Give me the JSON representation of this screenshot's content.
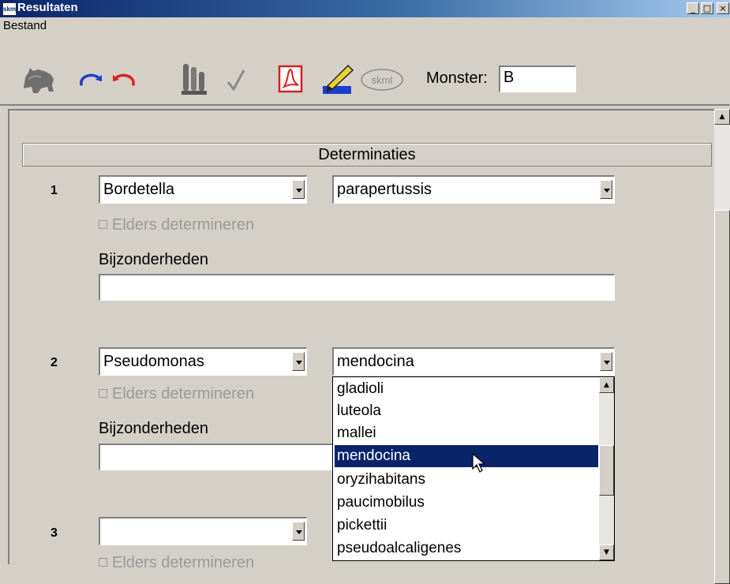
{
  "window": {
    "title": "Resultaten",
    "icon_text": "skml",
    "min_glyph": "_",
    "max_glyph": "□",
    "close_glyph": "×"
  },
  "menu": {
    "bestand": "Bestand"
  },
  "toolbar": {
    "icons": [
      "animal-icon",
      "redo-icon",
      "undo-icon",
      "test-tubes-icon",
      "checkmark-icon",
      "pdf-icon",
      "pen-sign-icon",
      "skml-logo-icon"
    ],
    "skml_text": "skml",
    "monster_label": "Monster:",
    "monster_value": "B"
  },
  "section": {
    "title": "Determinaties"
  },
  "rows": [
    {
      "num": "1",
      "genus": "Bordetella",
      "species": "parapertussis",
      "elders_label": "Elders determineren",
      "bijz_label": "Bijzonderheden",
      "bijz_value": ""
    },
    {
      "num": "2",
      "genus": "Pseudomonas",
      "species": "mendocina",
      "elders_label": "Elders determineren",
      "bijz_label": "Bijzonderheden",
      "bijz_value": ""
    },
    {
      "num": "3",
      "genus": "",
      "elders_label": "Elders determineren"
    }
  ],
  "dropdown": {
    "items": [
      "gladioli",
      "luteola",
      "mallei",
      "mendocina",
      "oryzihabitans",
      "paucimobilus",
      "pickettii",
      "pseudoalcaligenes"
    ],
    "selected": "mendocina"
  },
  "colors": {
    "selection": "#0a246a",
    "title_gradient_start": "#0a246a",
    "window_bg": "#d4d0c8",
    "redo": "#1a3fc8",
    "undo": "#e02020"
  }
}
